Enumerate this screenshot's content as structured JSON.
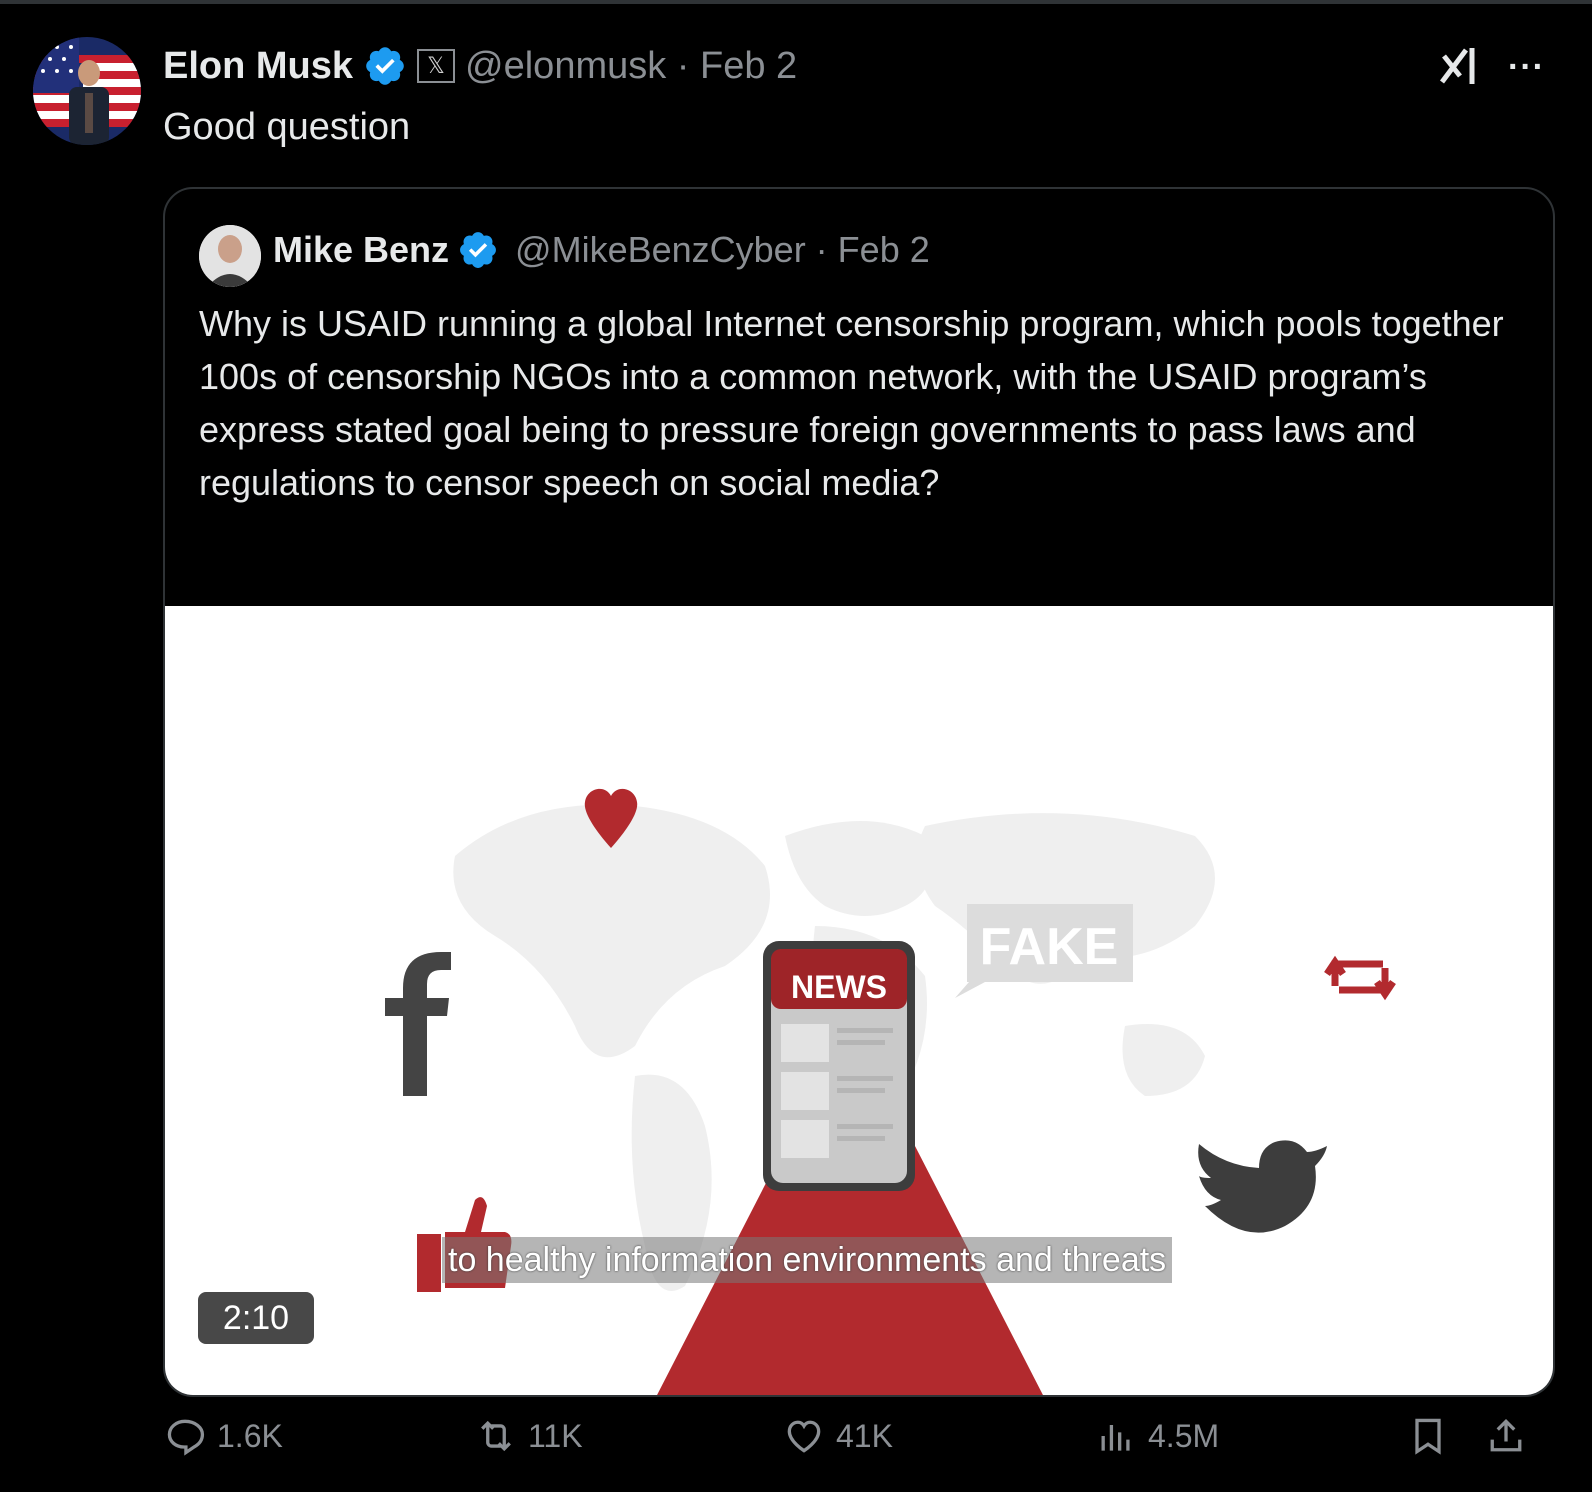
{
  "tweet": {
    "author": {
      "name": "Elon Musk",
      "handle": "@elonmusk · Feb 2",
      "badge": "𝕏"
    },
    "text": "Good question",
    "more": "···"
  },
  "quote": {
    "author": {
      "name": "Mike Benz",
      "handle": "@MikeBenzCyber · Feb 2"
    },
    "text": "Why is USAID running a global Internet censorship program, which pools together 100s of censorship NGOs into a common network, with the USAID program’s express stated goal being to pressure foreign governments to pass laws and regulations to censor speech on social media?",
    "video": {
      "caption": "to healthy information environments and threats",
      "duration": "2:10",
      "phone_label": "NEWS",
      "bubble_label": "FAKE"
    }
  },
  "actions": {
    "replies": "1.6K",
    "reposts": "11K",
    "likes": "41K",
    "views": "4.5M"
  },
  "colors": {
    "background": "#000000",
    "verified": "#1d9bf0",
    "muted_text": "#8b8f94",
    "video_red": "#b22a2e"
  }
}
